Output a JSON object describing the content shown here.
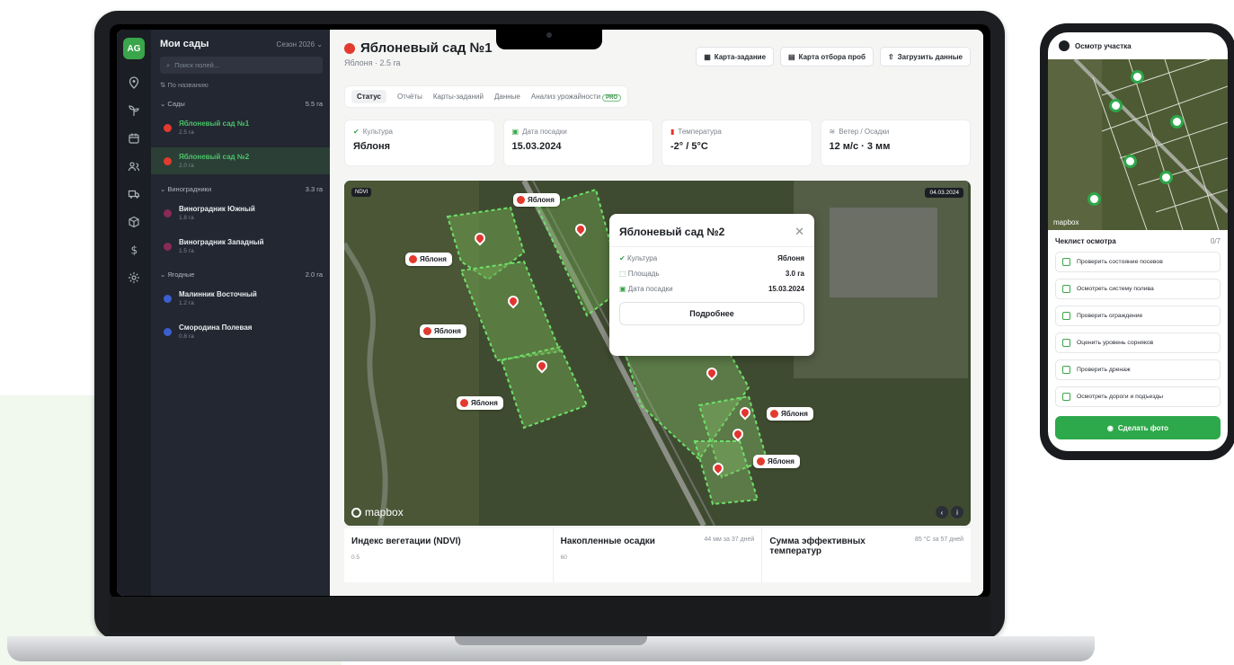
{
  "sidebar": {
    "avatar": "AG",
    "title": "Мои сады",
    "season": "Сезон 2026 ⌄",
    "search_placeholder": "Поиск полей...",
    "sort": "⇅ По названию",
    "groups": [
      {
        "name": "⌄ Сады",
        "area": "5.5 га",
        "items": [
          {
            "name": "Яблоневый сад №1",
            "area": "2.5 га",
            "color": "#e23b2e"
          },
          {
            "name": "Яблоневый сад №2",
            "area": "2.0 га",
            "color": "#e23b2e"
          }
        ]
      },
      {
        "name": "⌄ Виноградники",
        "area": "3.3 га",
        "items": [
          {
            "name": "Виноградник Южный",
            "area": "1.8 га",
            "color": "#8a2a56"
          },
          {
            "name": "Виноградник Западный",
            "area": "1.5 га",
            "color": "#8a2a56"
          }
        ]
      },
      {
        "name": "⌄ Ягодные",
        "area": "2.0 га",
        "items": [
          {
            "name": "Малинник Восточный",
            "area": "1.2 га",
            "color": "#3b5fd0"
          },
          {
            "name": "Смородина Полевая",
            "area": "0.8 га",
            "color": "#3b5fd0"
          }
        ]
      }
    ]
  },
  "header": {
    "title": "Яблоневый сад №1",
    "subtitle": "Яблоня · 2.5 га",
    "actions": [
      "Карта-задание",
      "Карта отбора проб",
      "Загрузить данные"
    ]
  },
  "tabs": [
    "Статус",
    "Отчёты",
    "Карты-заданий",
    "Данные",
    "Анализ урожайности"
  ],
  "pro_badge": "PRO",
  "cards": [
    {
      "label": "Культура",
      "value": "Яблоня"
    },
    {
      "label": "Дата посадки",
      "value": "15.03.2024"
    },
    {
      "label": "Температура",
      "value": "-2° / 5°C"
    },
    {
      "label": "Ветер / Осадки",
      "value": "12 м/с · 3 мм"
    }
  ],
  "map": {
    "layer": "NDVI",
    "date": "04.03.2024",
    "attribution": "mapbox",
    "tag_label": "Яблоня",
    "popup": {
      "title": "Яблоневый сад №2",
      "rows": [
        {
          "label": "Культура",
          "value": "Яблоня"
        },
        {
          "label": "Площадь",
          "value": "3.0 га"
        },
        {
          "label": "Дата посадки",
          "value": "15.03.2024"
        }
      ],
      "button": "Подробнее"
    }
  },
  "bottom": [
    {
      "title": "Индекс вегетации (NDVI)",
      "note": "",
      "axis": "0.5"
    },
    {
      "title": "Накопленные осадки",
      "note": "44 мм за 37 дней",
      "axis": "60"
    },
    {
      "title": "Сумма эффективных температур",
      "note": "85 °C за 57 дней",
      "axis": ""
    }
  ],
  "phone": {
    "title": "Осмотр участка",
    "attribution": "mapbox",
    "checklist_title": "Чеклист осмотра",
    "checklist_count": "0/7",
    "items": [
      "Проверить состояние посевов",
      "Осмотреть систему полива",
      "Проверить ограждение",
      "Оценить уровень сорняков",
      "Проверить дренаж",
      "Осмотреть дороги и подъезды"
    ],
    "photo_button": "Сделать фото"
  },
  "colors": {
    "accent": "#2da84a",
    "sidebar": "#232731",
    "pin": "#e3342f"
  }
}
